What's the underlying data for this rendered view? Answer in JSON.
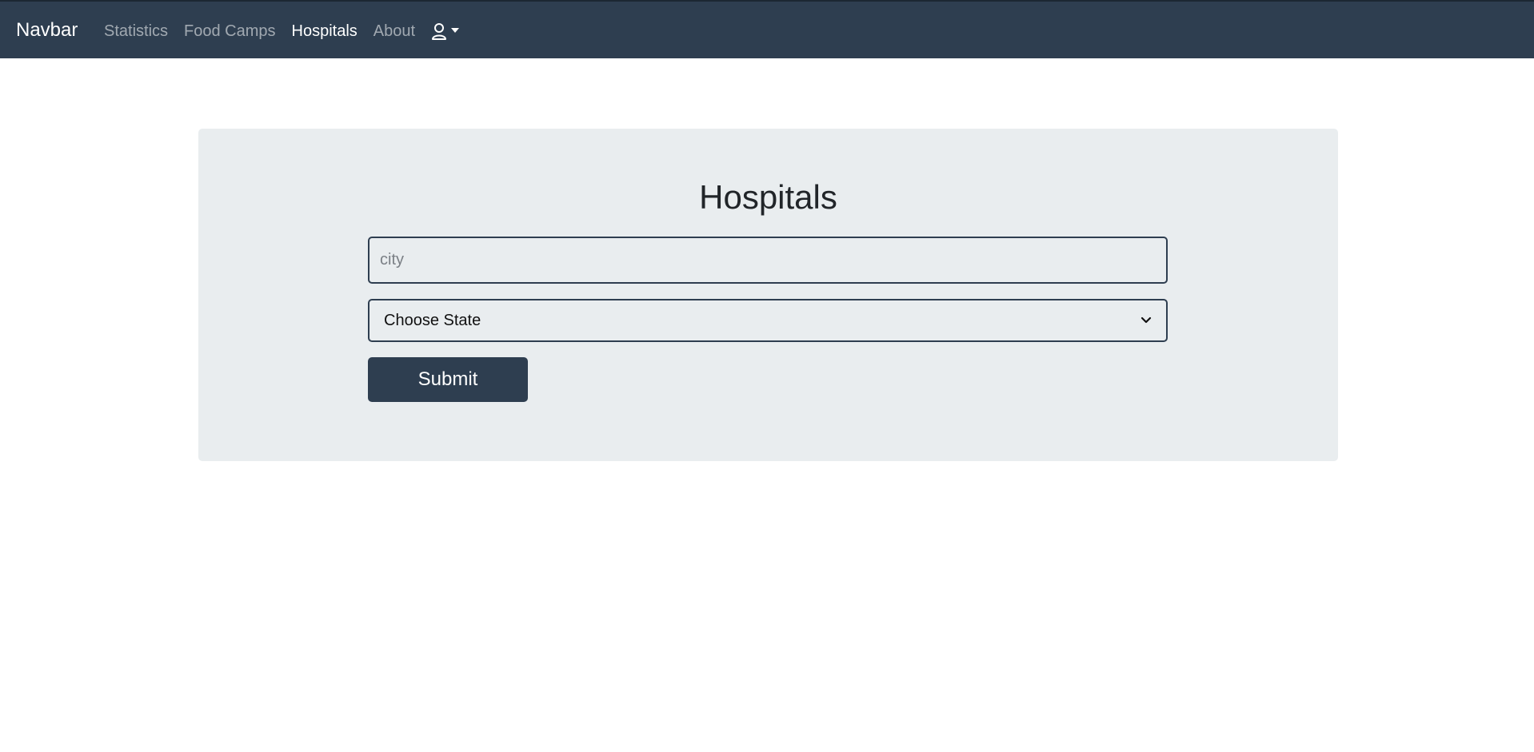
{
  "navbar": {
    "brand": "Navbar",
    "links": [
      {
        "label": "Statistics",
        "active": false
      },
      {
        "label": "Food Camps",
        "active": false
      },
      {
        "label": "Hospitals",
        "active": true
      },
      {
        "label": "About",
        "active": false
      }
    ],
    "user_icon": "user-icon",
    "background_color": "#2e3e50"
  },
  "main": {
    "title": "Hospitals",
    "city_input": {
      "placeholder": "city",
      "value": ""
    },
    "state_select": {
      "selected": "Choose State"
    },
    "submit_label": "Submit",
    "panel_color": "#e9edef",
    "accent_color": "#2e3e50"
  }
}
